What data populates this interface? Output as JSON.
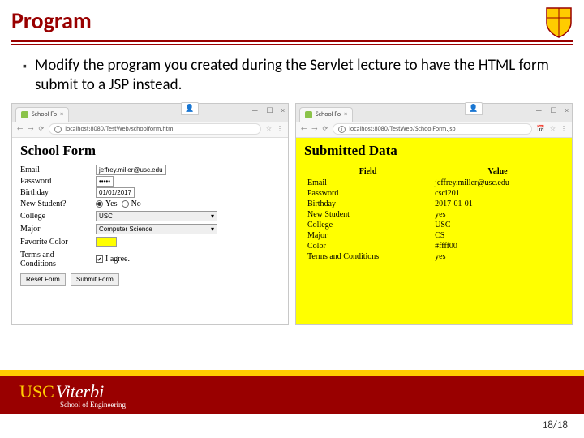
{
  "title": "Program",
  "bullet_text": "Modify the program you created during the Servlet lecture to have the HTML form submit to a JSP instead.",
  "page_number": "18/18",
  "logo": {
    "usc": "USC",
    "viterbi": "Viterbi",
    "sub": "School of Engineering"
  },
  "left_browser": {
    "tab_title": "School Fo",
    "url": "localhost:8080/TestWeb/schoolform.html",
    "heading": "School Form",
    "fields": {
      "email_label": "Email",
      "email_value": "jeffrey.miller@usc.edu",
      "password_label": "Password",
      "password_value": "•••••",
      "birthday_label": "Birthday",
      "birthday_value": "01/01/2017",
      "newstudent_label": "New Student?",
      "yes": "Yes",
      "no": "No",
      "college_label": "College",
      "college_value": "USC",
      "major_label": "Major",
      "major_value": "Computer Science",
      "color_label": "Favorite Color",
      "terms_label": "Terms and Conditions",
      "agree": "I agree.",
      "reset": "Reset Form",
      "submit": "Submit Form"
    }
  },
  "right_browser": {
    "tab_title": "School Fo",
    "url": "localhost:8080/TestWeb/SchoolForm.jsp",
    "heading": "Submitted Data",
    "table": {
      "head_field": "Field",
      "head_value": "Value",
      "rows": [
        {
          "f": "Email",
          "v": "jeffrey.miller@usc.edu"
        },
        {
          "f": "Password",
          "v": "csci201"
        },
        {
          "f": "Birthday",
          "v": "2017-01-01"
        },
        {
          "f": "New Student",
          "v": "yes"
        },
        {
          "f": "College",
          "v": "USC"
        },
        {
          "f": "Major",
          "v": "CS"
        },
        {
          "f": "Color",
          "v": "#ffff00"
        },
        {
          "f": "Terms and Conditions",
          "v": "yes"
        }
      ]
    }
  }
}
